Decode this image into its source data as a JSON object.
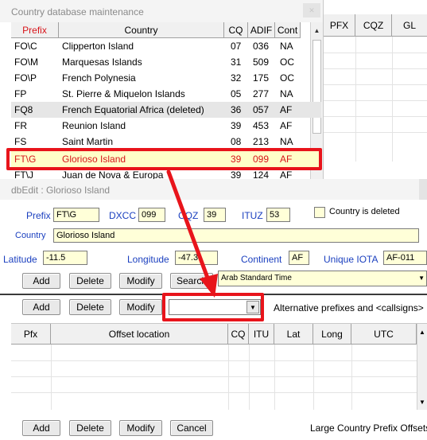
{
  "country_window": {
    "title": "Country database maintenance",
    "columns": [
      "Prefix",
      "Country",
      "CQ",
      "ADIF",
      "Cont"
    ],
    "rows": [
      {
        "prefix": "FO\\C",
        "country": "Clipperton Island",
        "cq": "07",
        "adif": "036",
        "cont": "NA"
      },
      {
        "prefix": "FO\\M",
        "country": "Marquesas Islands",
        "cq": "31",
        "adif": "509",
        "cont": "OC"
      },
      {
        "prefix": "FO\\P",
        "country": "French Polynesia",
        "cq": "32",
        "adif": "175",
        "cont": "OC"
      },
      {
        "prefix": "FP",
        "country": "St. Pierre & Miquelon Islands",
        "cq": "05",
        "adif": "277",
        "cont": "NA"
      },
      {
        "prefix": "FQ8",
        "country": "French Equatorial Africa (deleted)",
        "cq": "36",
        "adif": "057",
        "cont": "AF"
      },
      {
        "prefix": "FR",
        "country": "Reunion Island",
        "cq": "39",
        "adif": "453",
        "cont": "AF"
      },
      {
        "prefix": "FS",
        "country": "Saint Martin",
        "cq": "08",
        "adif": "213",
        "cont": "NA"
      },
      {
        "prefix": "FT\\G",
        "country": "Glorioso Island",
        "cq": "39",
        "adif": "099",
        "cont": "AF"
      }
    ],
    "partial_row": {
      "prefix": "FT\\J",
      "country": "Juan de Nova & Europa",
      "cq": "39",
      "adif": "124",
      "cont": "AF"
    }
  },
  "right_grid": {
    "columns": [
      "PFX",
      "CQZ",
      "GL"
    ]
  },
  "edit_panel": {
    "title": "dbEdit : Glorioso Island",
    "prefix_label": "Prefix",
    "prefix_value": "FT\\G",
    "dxcc_label": "DXCC",
    "dxcc_value": "099",
    "cqz_label": "CQZ",
    "cqz_value": "39",
    "ituz_label": "ITUZ",
    "ituz_value": "53",
    "deleted_label": "Country is deleted",
    "country_label": "Country",
    "country_value": "Glorioso Island",
    "latitude_label": "Latitude",
    "latitude_value": "-11.5",
    "longitude_label": "Longitude",
    "longitude_value": "-47.3",
    "continent_label": "Continent",
    "continent_value": "AF",
    "iota_label": "Unique IOTA",
    "iota_value": "AF-011",
    "timezone_value": "Arab Standard Time",
    "buttons": {
      "add": "Add",
      "delete": "Delete",
      "modify": "Modify",
      "search": "Search"
    }
  },
  "alt_prefix": {
    "buttons": {
      "add": "Add",
      "delete": "Delete",
      "modify": "Modify"
    },
    "combo_value": "",
    "label": "Alternative prefixes and <callsigns>"
  },
  "offsets": {
    "columns": [
      "Pfx",
      "Offset location",
      "CQ",
      "ITU",
      "Lat",
      "Long",
      "UTC"
    ],
    "buttons": {
      "add": "Add",
      "delete": "Delete",
      "modify": "Modify",
      "cancel": "Cancel"
    },
    "label": "Large Country Prefix Offsets"
  },
  "colors": {
    "highlight_red": "#e8141b",
    "selected_row_bg": "#ffffc8",
    "label_blue": "#1a3fbf"
  }
}
